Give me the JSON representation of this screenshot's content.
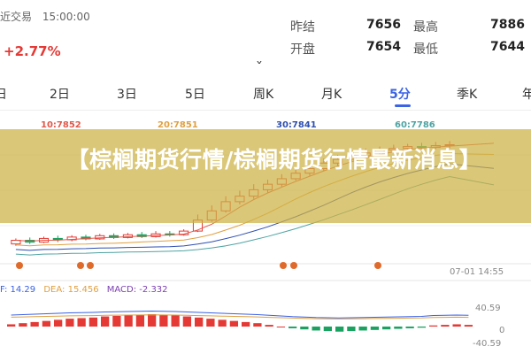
{
  "header": {
    "exchange": "近交易",
    "time": "15:00:00",
    "change_pct": "+2.77%",
    "stats": [
      {
        "label": "昨结",
        "value": "7656"
      },
      {
        "label": "最高",
        "value": "7886"
      },
      {
        "label": "开盘",
        "value": "7654"
      },
      {
        "label": "最低",
        "value": "7644"
      }
    ]
  },
  "tabs": [
    "日",
    "2日",
    "3日",
    "5日",
    "周K",
    "月K",
    "5分",
    "季K",
    "年"
  ],
  "active_tab": "5分",
  "ma_legend": [
    {
      "text": "10:7852",
      "color": "#e0594b"
    },
    {
      "text": "20:7851",
      "color": "#e0a040"
    },
    {
      "text": "30:7841",
      "color": "#2e4fb0"
    },
    {
      "text": "60:7786",
      "color": "#4fa3a3"
    }
  ],
  "timestamp": "07-01 14:55",
  "macd": {
    "dif": "F: 14.29",
    "dea": "DEA: 15.456",
    "macd": "MACD: -2.332",
    "axis_top": "40.59",
    "axis_zero": "0",
    "axis_bottom": "-40.59",
    "colors": {
      "dif": "#3a63e5",
      "dea": "#e0a040",
      "macd": "#7a3fb0"
    }
  },
  "banner": {
    "title": "【棕榈期货行情/棕榈期货行情最新消息】"
  },
  "chart_data": {
    "type": "candlestick",
    "candles": [
      {
        "o": 7648,
        "c": 7656,
        "h": 7660,
        "l": 7644
      },
      {
        "o": 7656,
        "c": 7652,
        "h": 7662,
        "l": 7648
      },
      {
        "o": 7652,
        "c": 7660,
        "h": 7664,
        "l": 7650
      },
      {
        "o": 7660,
        "c": 7657,
        "h": 7666,
        "l": 7652
      },
      {
        "o": 7657,
        "c": 7663,
        "h": 7667,
        "l": 7654
      },
      {
        "o": 7663,
        "c": 7659,
        "h": 7668,
        "l": 7656
      },
      {
        "o": 7659,
        "c": 7666,
        "h": 7670,
        "l": 7657
      },
      {
        "o": 7666,
        "c": 7662,
        "h": 7671,
        "l": 7659
      },
      {
        "o": 7662,
        "c": 7668,
        "h": 7672,
        "l": 7660
      },
      {
        "o": 7668,
        "c": 7664,
        "h": 7674,
        "l": 7661
      },
      {
        "o": 7664,
        "c": 7670,
        "h": 7676,
        "l": 7662
      },
      {
        "o": 7670,
        "c": 7668,
        "h": 7676,
        "l": 7664
      },
      {
        "o": 7668,
        "c": 7676,
        "h": 7680,
        "l": 7666
      },
      {
        "o": 7676,
        "c": 7700,
        "h": 7712,
        "l": 7674
      },
      {
        "o": 7700,
        "c": 7720,
        "h": 7732,
        "l": 7696
      },
      {
        "o": 7720,
        "c": 7740,
        "h": 7752,
        "l": 7716
      },
      {
        "o": 7740,
        "c": 7752,
        "h": 7764,
        "l": 7734
      },
      {
        "o": 7752,
        "c": 7766,
        "h": 7778,
        "l": 7746
      },
      {
        "o": 7766,
        "c": 7778,
        "h": 7788,
        "l": 7760
      },
      {
        "o": 7778,
        "c": 7790,
        "h": 7800,
        "l": 7772
      },
      {
        "o": 7790,
        "c": 7802,
        "h": 7812,
        "l": 7786
      },
      {
        "o": 7802,
        "c": 7812,
        "h": 7822,
        "l": 7796
      },
      {
        "o": 7812,
        "c": 7824,
        "h": 7834,
        "l": 7806
      },
      {
        "o": 7824,
        "c": 7832,
        "h": 7842,
        "l": 7818
      },
      {
        "o": 7832,
        "c": 7840,
        "h": 7850,
        "l": 7826
      },
      {
        "o": 7840,
        "c": 7846,
        "h": 7856,
        "l": 7834
      },
      {
        "o": 7846,
        "c": 7852,
        "h": 7860,
        "l": 7840
      },
      {
        "o": 7852,
        "c": 7856,
        "h": 7864,
        "l": 7846
      },
      {
        "o": 7856,
        "c": 7860,
        "h": 7866,
        "l": 7850
      },
      {
        "o": 7860,
        "c": 7858,
        "h": 7868,
        "l": 7852
      },
      {
        "o": 7858,
        "c": 7862,
        "h": 7870,
        "l": 7854
      },
      {
        "o": 7862,
        "c": 7864,
        "h": 7872,
        "l": 7856
      }
    ],
    "macd_hist": [
      4,
      6,
      8,
      10,
      12,
      14,
      15,
      16,
      18,
      19,
      20,
      21,
      22,
      21,
      20,
      18,
      16,
      14,
      12,
      10,
      8,
      6,
      3,
      0,
      -3,
      -5,
      -7,
      -8,
      -9,
      -8,
      -7,
      -6,
      -5,
      -4,
      -3,
      -2,
      2,
      3,
      4,
      3
    ],
    "ylim": [
      7630,
      7890
    ],
    "macd_ylim": [
      -40.59,
      40.59
    ]
  }
}
